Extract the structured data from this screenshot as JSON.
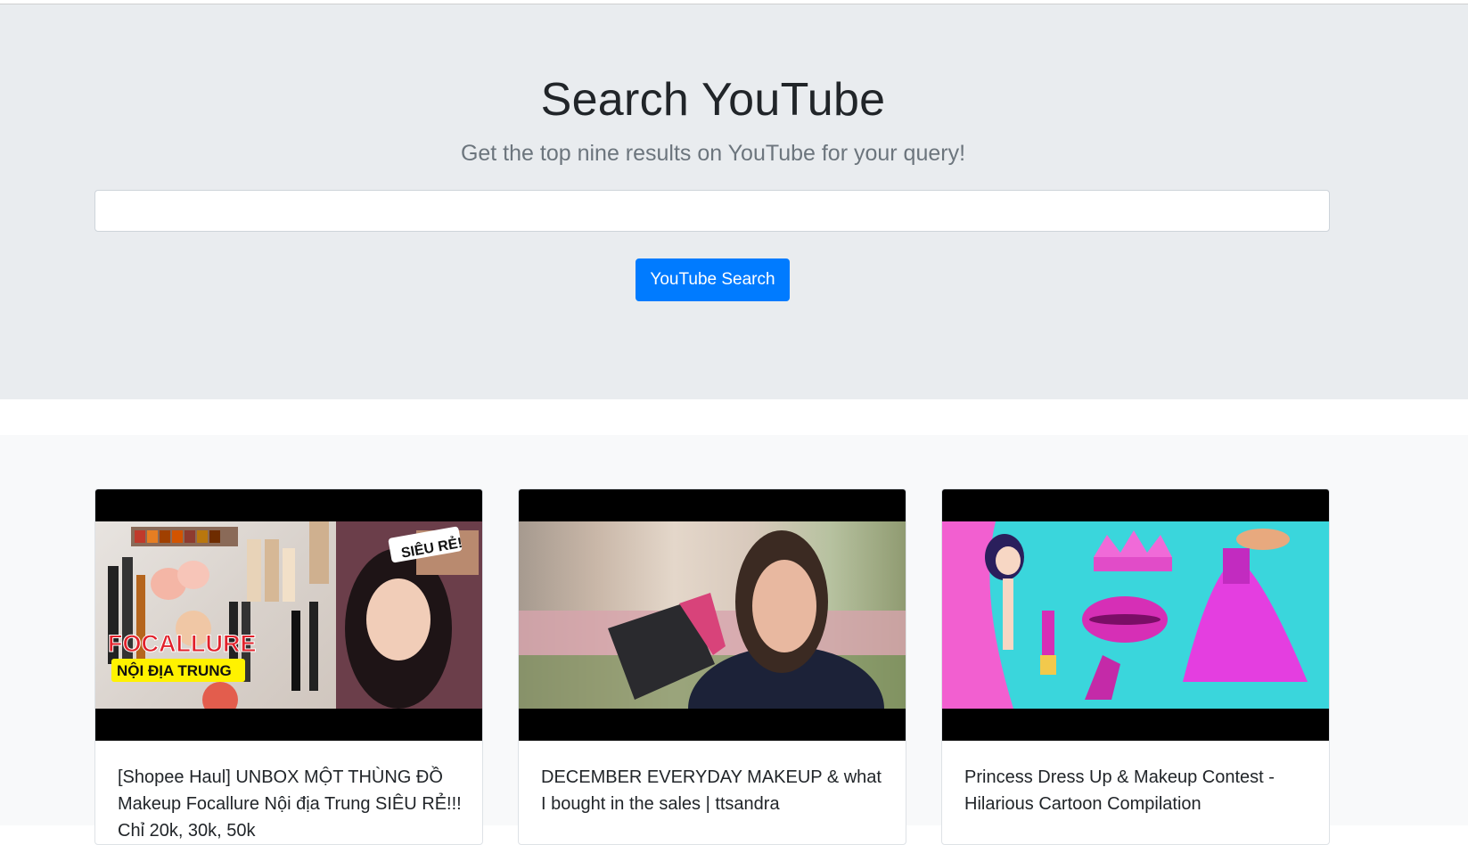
{
  "header": {
    "title": "Search YouTube",
    "subtitle": "Get the top nine results on YouTube for your query!"
  },
  "search": {
    "value": "",
    "button_label": "YouTube Search"
  },
  "results": [
    {
      "title": "[Shopee Haul] UNBOX MỘT THÙNG ĐỒ Makeup Focallure Nội địa Trung SIÊU RẺ!!! Chỉ 20k, 30k, 50k",
      "thumb_text_1": "FOCALLURE",
      "thumb_text_2": "NỘI ĐỊA TRUNG",
      "thumb_text_3": "SIÊU RẺ!"
    },
    {
      "title": "DECEMBER EVERYDAY MAKEUP & what I bought in the sales | ttsandra"
    },
    {
      "title": "Princess Dress Up & Makeup Contest - Hilarious Cartoon Compilation"
    }
  ],
  "colors": {
    "jumbotron_bg": "#e9ecef",
    "primary": "#007bff",
    "results_bg": "#f8f9fa"
  }
}
